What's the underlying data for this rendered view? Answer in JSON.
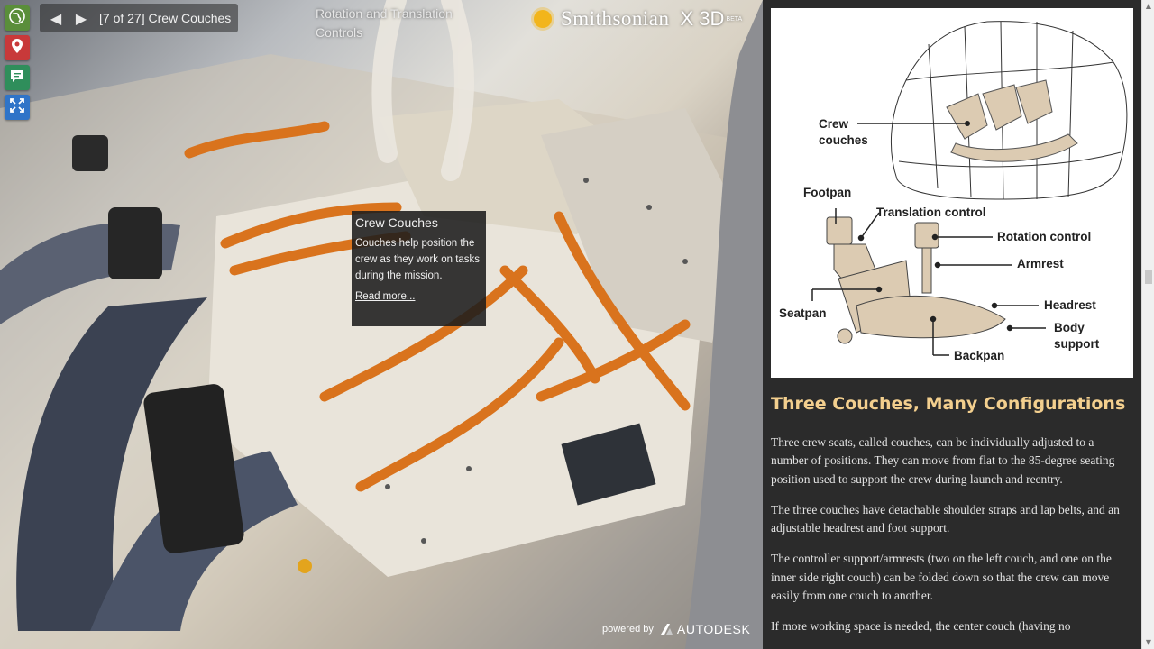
{
  "toolbar": {
    "home_icon": "globe-icon",
    "locations_icon": "map-pin-icon",
    "annotations_icon": "speech-bubble-icon",
    "fullscreen_icon": "expand-icon"
  },
  "tour_nav": {
    "prev_icon": "triangle-left-icon",
    "next_icon": "triangle-right-icon",
    "title": "[7 of 27] Crew Couches",
    "next_stop": "Rotation and Translation Controls"
  },
  "brand": {
    "name": "Smithsonian",
    "product": "X 3D",
    "tag": "BETA"
  },
  "annotation": {
    "title": "Crew Couches",
    "body": "Couches help position the crew as they work on tasks during the mission.",
    "link": "Read more..."
  },
  "footer": {
    "powered_by": "powered by",
    "vendor": "AUTODESK"
  },
  "diagram": {
    "labels": {
      "crew_couches_1": "Crew",
      "crew_couches_2": "couches",
      "footpan": "Footpan",
      "translation_control": "Translation control",
      "rotation_control": "Rotation control",
      "armrest": "Armrest",
      "seatpan": "Seatpan",
      "headrest": "Headrest",
      "body_support_1": "Body",
      "body_support_2": "support",
      "backpan": "Backpan"
    }
  },
  "article": {
    "title": "Three Couches, Many Configurations",
    "paragraphs": [
      "Three crew seats, called couches, can be individually adjusted to a number of positions. They can move from flat to the 85-degree seating position used to support the crew during launch and reentry.",
      "The three couches have detachable shoulder straps and lap belts, and an adjustable headrest and foot support.",
      "The controller support/armrests (two on the left couch, and one on the inner side right couch) can be folded down so that the crew can move easily from one couch to another.",
      "If more working space is needed, the center couch (having no"
    ]
  },
  "colors": {
    "article_title": "#f3cf8e",
    "strap_orange": "#d9731d",
    "home_green": "#5a8e3a",
    "pin_red": "#c8393a",
    "chat_green": "#2f8e5b",
    "expand_blue": "#2f74c8"
  }
}
